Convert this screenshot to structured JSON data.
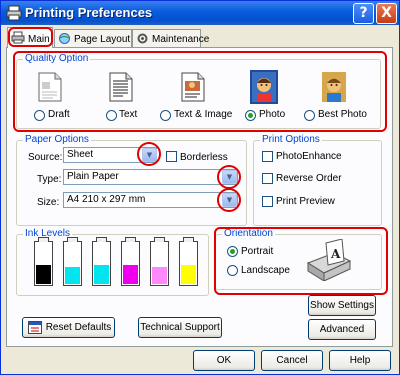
{
  "window": {
    "title": "Printing Preferences",
    "help_glyph": "?",
    "close_glyph": "X"
  },
  "tabs": [
    {
      "label": "Main",
      "icon": "printer-icon"
    },
    {
      "label": "Page Layout",
      "icon": "page-layout-icon"
    },
    {
      "label": "Maintenance",
      "icon": "maintenance-icon"
    }
  ],
  "quality": {
    "legend": "Quality Option",
    "options": [
      {
        "label": "Draft",
        "selected": false
      },
      {
        "label": "Text",
        "selected": false
      },
      {
        "label": "Text & Image",
        "selected": false
      },
      {
        "label": "Photo",
        "selected": true
      },
      {
        "label": "Best Photo",
        "selected": false
      }
    ]
  },
  "paper": {
    "legend": "Paper Options",
    "source_label": "Source:",
    "source_value": "Sheet",
    "borderless_label": "Borderless",
    "type_label": "Type:",
    "type_value": "Plain Paper",
    "size_label": "Size:",
    "size_value": "A4 210 x 297 mm"
  },
  "print_options": {
    "legend": "Print Options",
    "items": [
      "PhotoEnhance",
      "Reverse Order",
      "Print Preview"
    ]
  },
  "ink": {
    "legend": "Ink Levels",
    "colors": [
      "#000000",
      "#00e5ee",
      "#00e5ee",
      "#ee00ee",
      "#ff88ff",
      "#ffff00"
    ],
    "levels": [
      0.45,
      0.4,
      0.45,
      0.45,
      0.4,
      0.45
    ]
  },
  "orientation": {
    "legend": "Orientation",
    "portrait_label": "Portrait",
    "landscape_label": "Landscape",
    "selected": "Portrait",
    "icon_letter": "A"
  },
  "buttons": {
    "show_settings": "Show Settings",
    "reset_defaults": "Reset Defaults",
    "technical_support": "Technical Support",
    "advanced": "Advanced",
    "ok": "OK",
    "cancel": "Cancel",
    "help": "Help"
  },
  "colors": {
    "highlight": "#e00000",
    "legend": "#0046d5",
    "titlebar": "#0a5fde"
  }
}
